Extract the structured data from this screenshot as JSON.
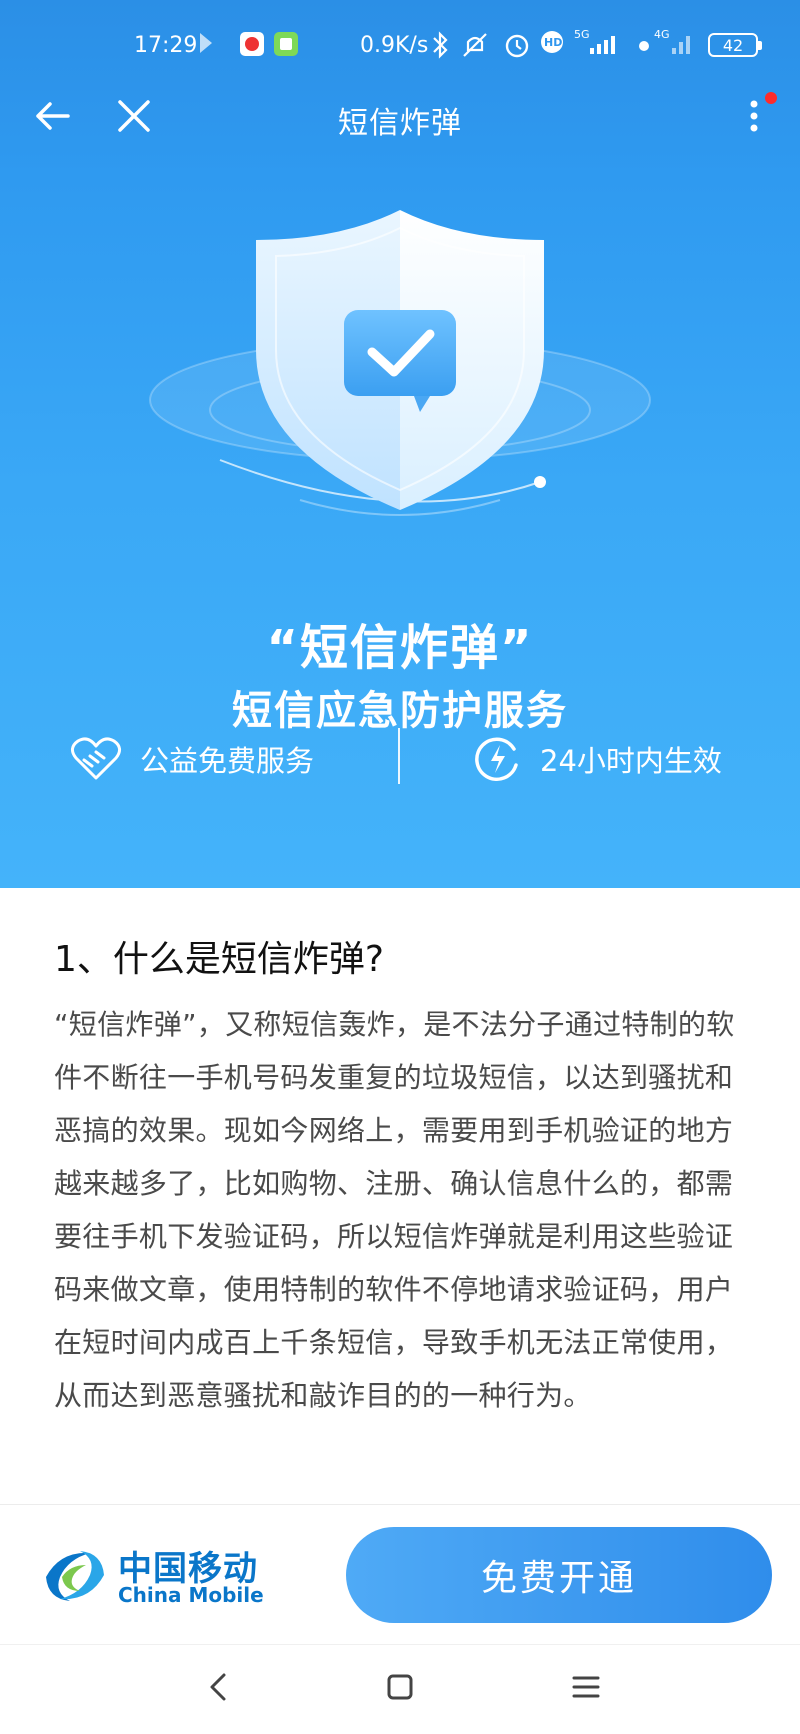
{
  "status_bar": {
    "time": "17:29",
    "network_speed": "0.9K/s",
    "battery": "42",
    "icons": [
      "play-icon",
      "app-icon",
      "app-icon-2",
      "bluetooth-icon",
      "mute-icon",
      "alarm-icon",
      "hd-icon",
      "signal-5g-icon",
      "signal-4g-icon"
    ]
  },
  "nav": {
    "title": "短信炸弹"
  },
  "hero": {
    "title": "“短信炸弹”",
    "subtitle": "短信应急防护服务",
    "feature_left": "公益免费服务",
    "feature_right": "24小时内生效"
  },
  "content": {
    "heading": "1、什么是短信炸弹?",
    "body": "“短信炸弹”，又称短信轰炸，是不法分子通过特制的软件不断往一手机号码发重复的垃圾短信，以达到骚扰和恶搞的效果。现如今网络上，需要用到手机验证的地方越来越多了，比如购物、注册、确认信息什么的，都需要往手机下发验证码，所以短信炸弹就是利用这些验证码来做文章，使用特制的软件不停地请求验证码，用户在短时间内成百上千条短信，导致手机无法正常使用，从而达到恶意骚扰和敲诈目的的一种行为。"
  },
  "action_bar": {
    "logo_cn": "中国移动",
    "logo_en": "China Mobile",
    "cta_label": "免费开通"
  },
  "colors": {
    "hero_top": "#2b8fe6",
    "hero_bottom": "#44b3fa",
    "brand": "#0a76c9",
    "cta": "#3b9af0"
  }
}
